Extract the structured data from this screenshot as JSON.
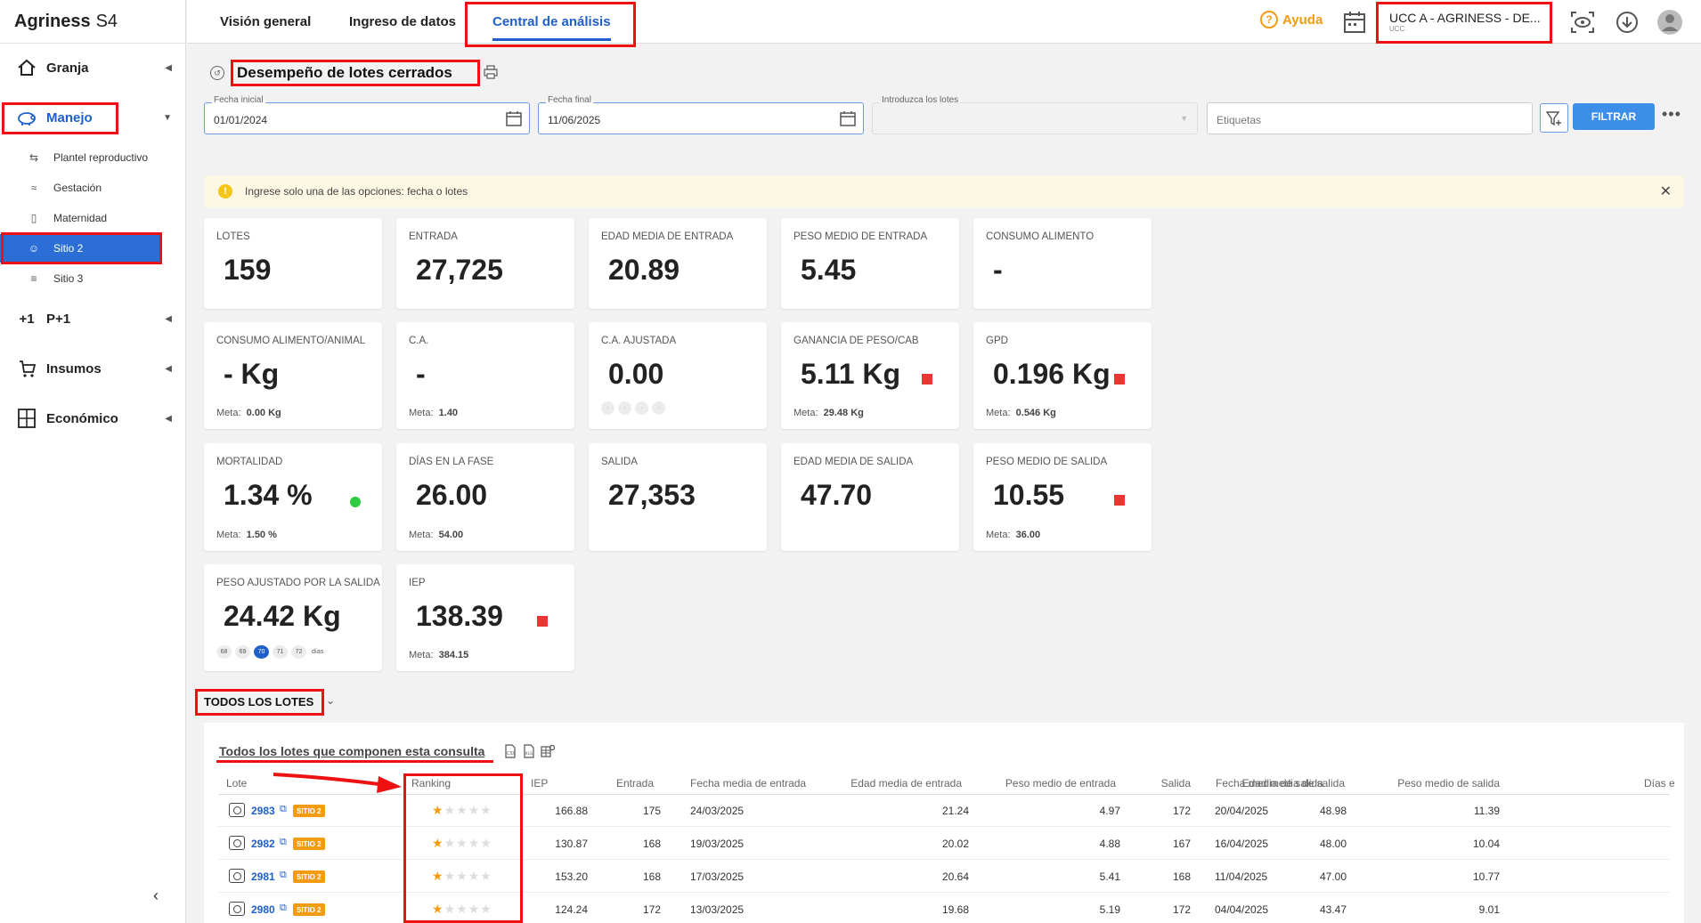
{
  "app": {
    "brand": "Agriness",
    "brand_suffix": "S4"
  },
  "sidebar": {
    "main_items": [
      {
        "label": "Granja",
        "icon": "home-icon"
      },
      {
        "label": "Manejo",
        "icon": "pig-icon"
      },
      {
        "label": "P+1",
        "icon": "plus-one-icon"
      },
      {
        "label": "Insumos",
        "icon": "cart-icon"
      },
      {
        "label": "Económico",
        "icon": "calculator-icon"
      }
    ],
    "sub_items": [
      {
        "label": "Plantel reproductivo"
      },
      {
        "label": "Gestación"
      },
      {
        "label": "Maternidad"
      },
      {
        "label": "Sitio 2"
      },
      {
        "label": "Sitio 3"
      }
    ]
  },
  "topbar": {
    "tabs": [
      {
        "label": "Visión general"
      },
      {
        "label": "Ingreso de datos"
      },
      {
        "label": "Central de análisis"
      }
    ],
    "help_label": "Ayuda",
    "farm_name": "UCC A - AGRINESS - DE...",
    "farm_sub": "UCC"
  },
  "page": {
    "title": "Desempeño de lotes cerrados"
  },
  "filters": {
    "start_label": "Fecha inicial",
    "start_value": "01/01/2024",
    "end_label": "Fecha final",
    "end_value": "11/06/2025",
    "lots_label": "Introduzca los lotes",
    "tags_placeholder": "Etiquetas",
    "filter_button": "FILTRAR"
  },
  "alert": {
    "text": "Ingrese solo una de las opciones: fecha o lotes"
  },
  "cards": [
    {
      "title": "LOTES",
      "value": "159"
    },
    {
      "title": "ENTRADA",
      "value": "27,725"
    },
    {
      "title": "EDAD MEDIA DE ENTRADA",
      "value": "20.89"
    },
    {
      "title": "PESO MEDIO DE ENTRADA",
      "value": "5.45"
    },
    {
      "title": "CONSUMO ALIMENTO",
      "value": "-"
    },
    {
      "title": "CONSUMO ALIMENTO/ANIMAL",
      "value": "- Kg",
      "meta_label": "Meta:",
      "meta_value": "0.00 Kg"
    },
    {
      "title": "C.A.",
      "value": "-",
      "meta_label": "Meta:",
      "meta_value": "1.40"
    },
    {
      "title": "C.A. AJUSTADA",
      "value": "0.00"
    },
    {
      "title": "GANANCIA DE PESO/CAB",
      "value": "5.11 Kg",
      "meta_label": "Meta:",
      "meta_value": "29.48 Kg",
      "status": "red"
    },
    {
      "title": "GPD",
      "value": "0.196 Kg",
      "meta_label": "Meta:",
      "meta_value": "0.546 Kg",
      "status": "red"
    },
    {
      "title": "MORTALIDAD",
      "value": "1.34 %",
      "meta_label": "Meta:",
      "meta_value": "1.50 %",
      "status": "green"
    },
    {
      "title": "DÍAS EN LA FASE",
      "value": "26.00",
      "meta_label": "Meta:",
      "meta_value": "54.00"
    },
    {
      "title": "SALIDA",
      "value": "27,353"
    },
    {
      "title": "EDAD MEDIA DE SALIDA",
      "value": "47.70"
    },
    {
      "title": "PESO MEDIO DE SALIDA",
      "value": "10.55",
      "meta_label": "Meta:",
      "meta_value": "36.00",
      "status": "red"
    },
    {
      "title": "PESO AJUSTADO POR LA SALIDA",
      "value": "24.42 Kg"
    },
    {
      "title": "IEP",
      "value": "138.39",
      "meta_label": "Meta:",
      "meta_value": "384.15",
      "status": "red"
    }
  ],
  "day_pills": {
    "days": [
      "68",
      "69",
      "70",
      "71",
      "72"
    ],
    "selected": "70",
    "unit": "días"
  },
  "section": {
    "title": "TODOS LOS LOTES"
  },
  "table": {
    "title": "Todos los lotes que componen esta consulta",
    "headers": [
      "Lote",
      "Ranking",
      "IEP",
      "Entrada",
      "Fecha media de entrada",
      "Edad media de entrada",
      "Peso medio de entrada",
      "Salida",
      "Fecha media de salida",
      "Edad media de salida",
      "Peso medio de salida",
      "Días e"
    ],
    "badge": "SITIO 2",
    "rows": [
      {
        "lote": "2983",
        "stars": 1,
        "iep": "166.88",
        "entrada": "175",
        "fecha_entrada": "24/03/2025",
        "edad_entrada": "21.24",
        "peso_entrada": "4.97",
        "salida": "172",
        "fecha_salida": "20/04/2025",
        "edad_salida": "48.98",
        "peso_salida": "11.39"
      },
      {
        "lote": "2982",
        "stars": 1,
        "iep": "130.87",
        "entrada": "168",
        "fecha_entrada": "19/03/2025",
        "edad_entrada": "20.02",
        "peso_entrada": "4.88",
        "salida": "167",
        "fecha_salida": "16/04/2025",
        "edad_salida": "48.00",
        "peso_salida": "10.04"
      },
      {
        "lote": "2981",
        "stars": 1,
        "iep": "153.20",
        "entrada": "168",
        "fecha_entrada": "17/03/2025",
        "edad_entrada": "20.64",
        "peso_entrada": "5.41",
        "salida": "168",
        "fecha_salida": "11/04/2025",
        "edad_salida": "47.00",
        "peso_salida": "10.77"
      },
      {
        "lote": "2980",
        "stars": 1,
        "iep": "124.24",
        "entrada": "172",
        "fecha_entrada": "13/03/2025",
        "edad_entrada": "19.68",
        "peso_entrada": "5.19",
        "salida": "172",
        "fecha_salida": "04/04/2025",
        "edad_salida": "43.47",
        "peso_salida": "9.01"
      }
    ]
  },
  "colors": {
    "accent": "#1e5fc9",
    "highlight": "#e11111",
    "badge": "#f39c12",
    "alert_bg": "#fcf8e3"
  }
}
